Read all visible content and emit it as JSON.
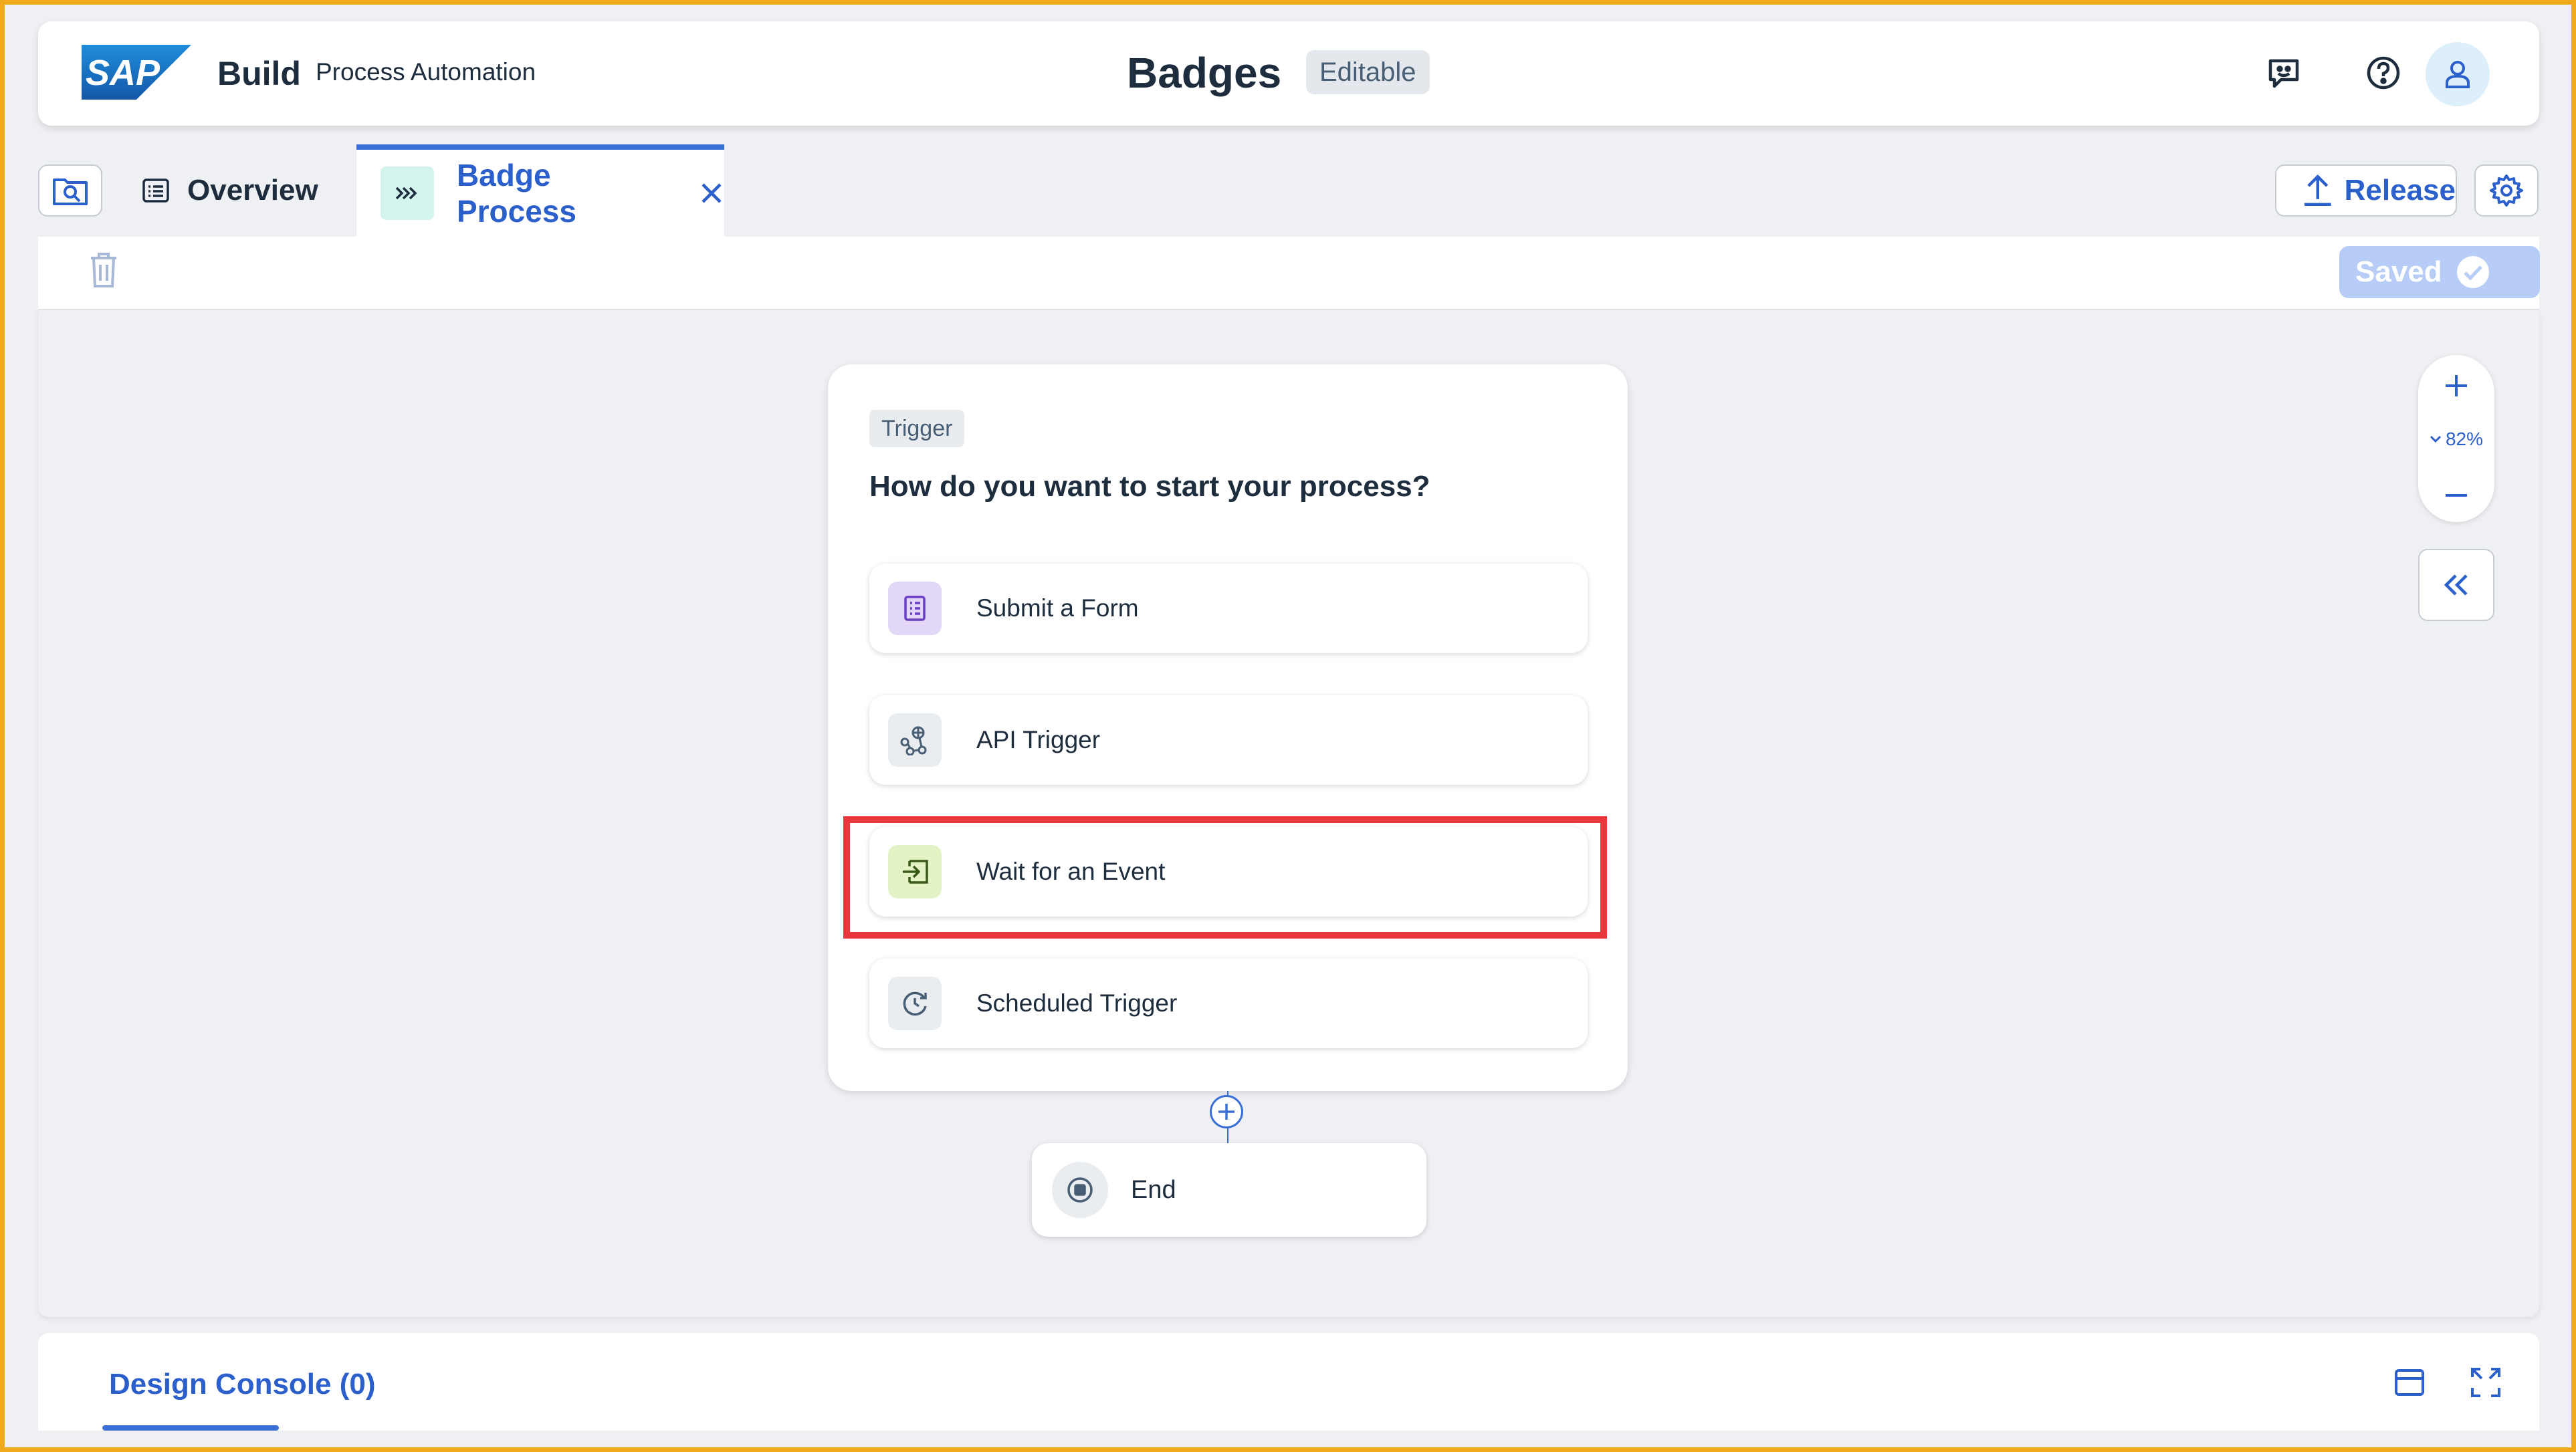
{
  "header": {
    "logo_text": "SAP",
    "brand": "Build",
    "product": "Process Automation",
    "project_title": "Badges",
    "status_badge": "Editable",
    "icons": [
      "feedback-icon",
      "help-icon",
      "user-avatar-icon"
    ]
  },
  "tabs": {
    "overview_label": "Overview",
    "active_label": "Badge Process",
    "release_label": "Release"
  },
  "toolbar": {
    "saved_label": "Saved"
  },
  "zoom": {
    "level": "82%"
  },
  "trigger_card": {
    "tag": "Trigger",
    "question": "How do you want to start your process?",
    "options": [
      {
        "label": "Submit a Form",
        "icon": "form-icon"
      },
      {
        "label": "API Trigger",
        "icon": "api-icon"
      },
      {
        "label": "Wait for an Event",
        "icon": "event-icon"
      },
      {
        "label": "Scheduled Trigger",
        "icon": "schedule-icon"
      }
    ]
  },
  "end_node": {
    "label": "End"
  },
  "console": {
    "tab_label": "Design Console (0)"
  },
  "colors": {
    "accent": "#2b5fcc",
    "highlight": "#e8383d",
    "frame": "#f0a81c"
  }
}
